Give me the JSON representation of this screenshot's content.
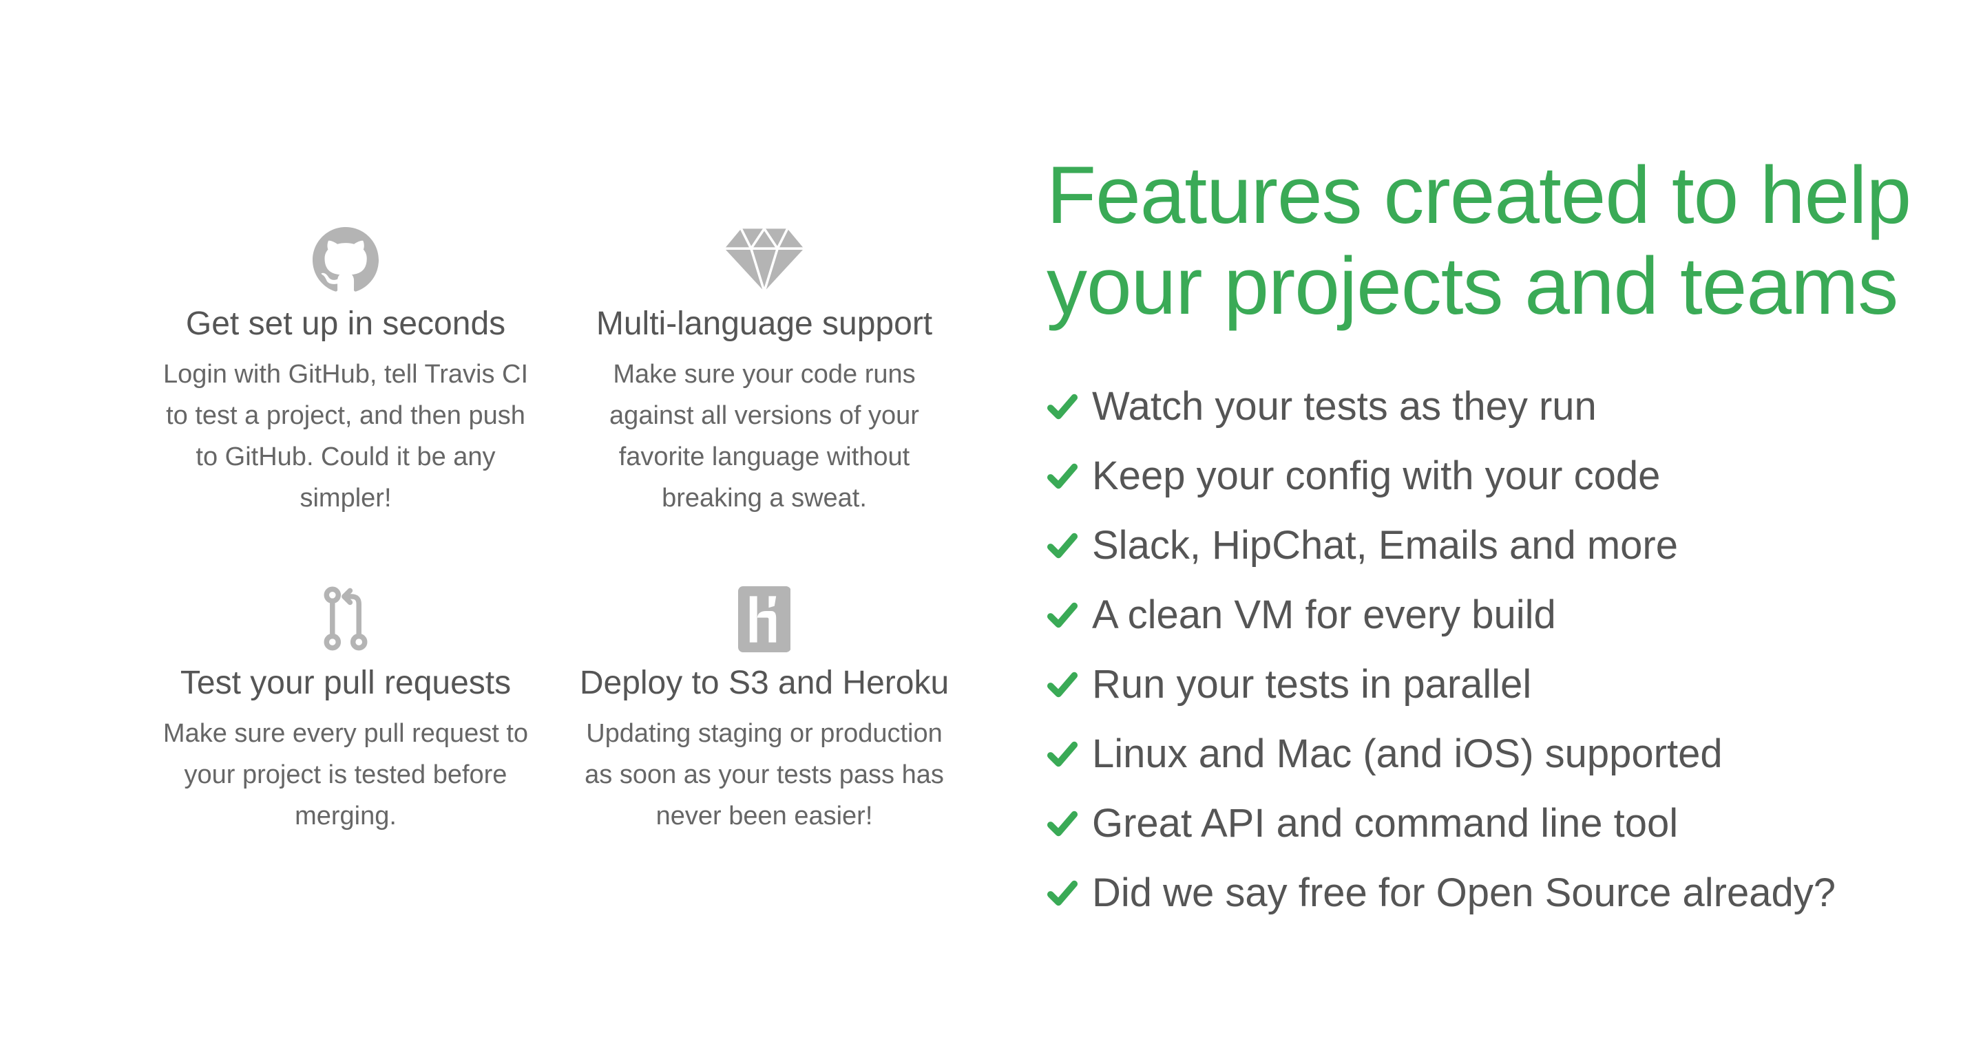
{
  "colors": {
    "accent_green": "#3aaa56",
    "icon_grey": "#b4b4b4",
    "text_grey": "#555555"
  },
  "features": [
    {
      "icon": "github-icon",
      "title": "Get set up in seconds",
      "desc_lines": [
        "Login with GitHub, tell Travis CI",
        "to test a project, and then push",
        "to GitHub. Could it be any",
        "simpler!"
      ]
    },
    {
      "icon": "diamond-icon",
      "title": "Multi-language support",
      "desc_lines": [
        "Make sure your code runs",
        "against all versions of your",
        "favorite language without",
        "breaking a sweat."
      ]
    },
    {
      "icon": "pull-request-icon",
      "title": "Test your pull requests",
      "desc_lines": [
        "Make sure every pull request to",
        "your project is tested before",
        "merging."
      ]
    },
    {
      "icon": "heroku-icon",
      "title": "Deploy to S3 and Heroku",
      "desc_lines": [
        "Updating staging or production",
        "as soon as your tests pass has",
        "never been easier!"
      ]
    }
  ],
  "headline": {
    "line1": "Features created to help",
    "line2": "your projects and teams"
  },
  "checklist": {
    "icon": "check-icon",
    "items": [
      "Watch your tests as they run",
      "Keep your config with your code",
      "Slack, HipChat, Emails and more",
      "A clean VM for every build",
      "Run your tests in parallel",
      "Linux and Mac (and iOS) supported",
      "Great API and command line tool",
      "Did we say free for Open Source already?"
    ]
  }
}
